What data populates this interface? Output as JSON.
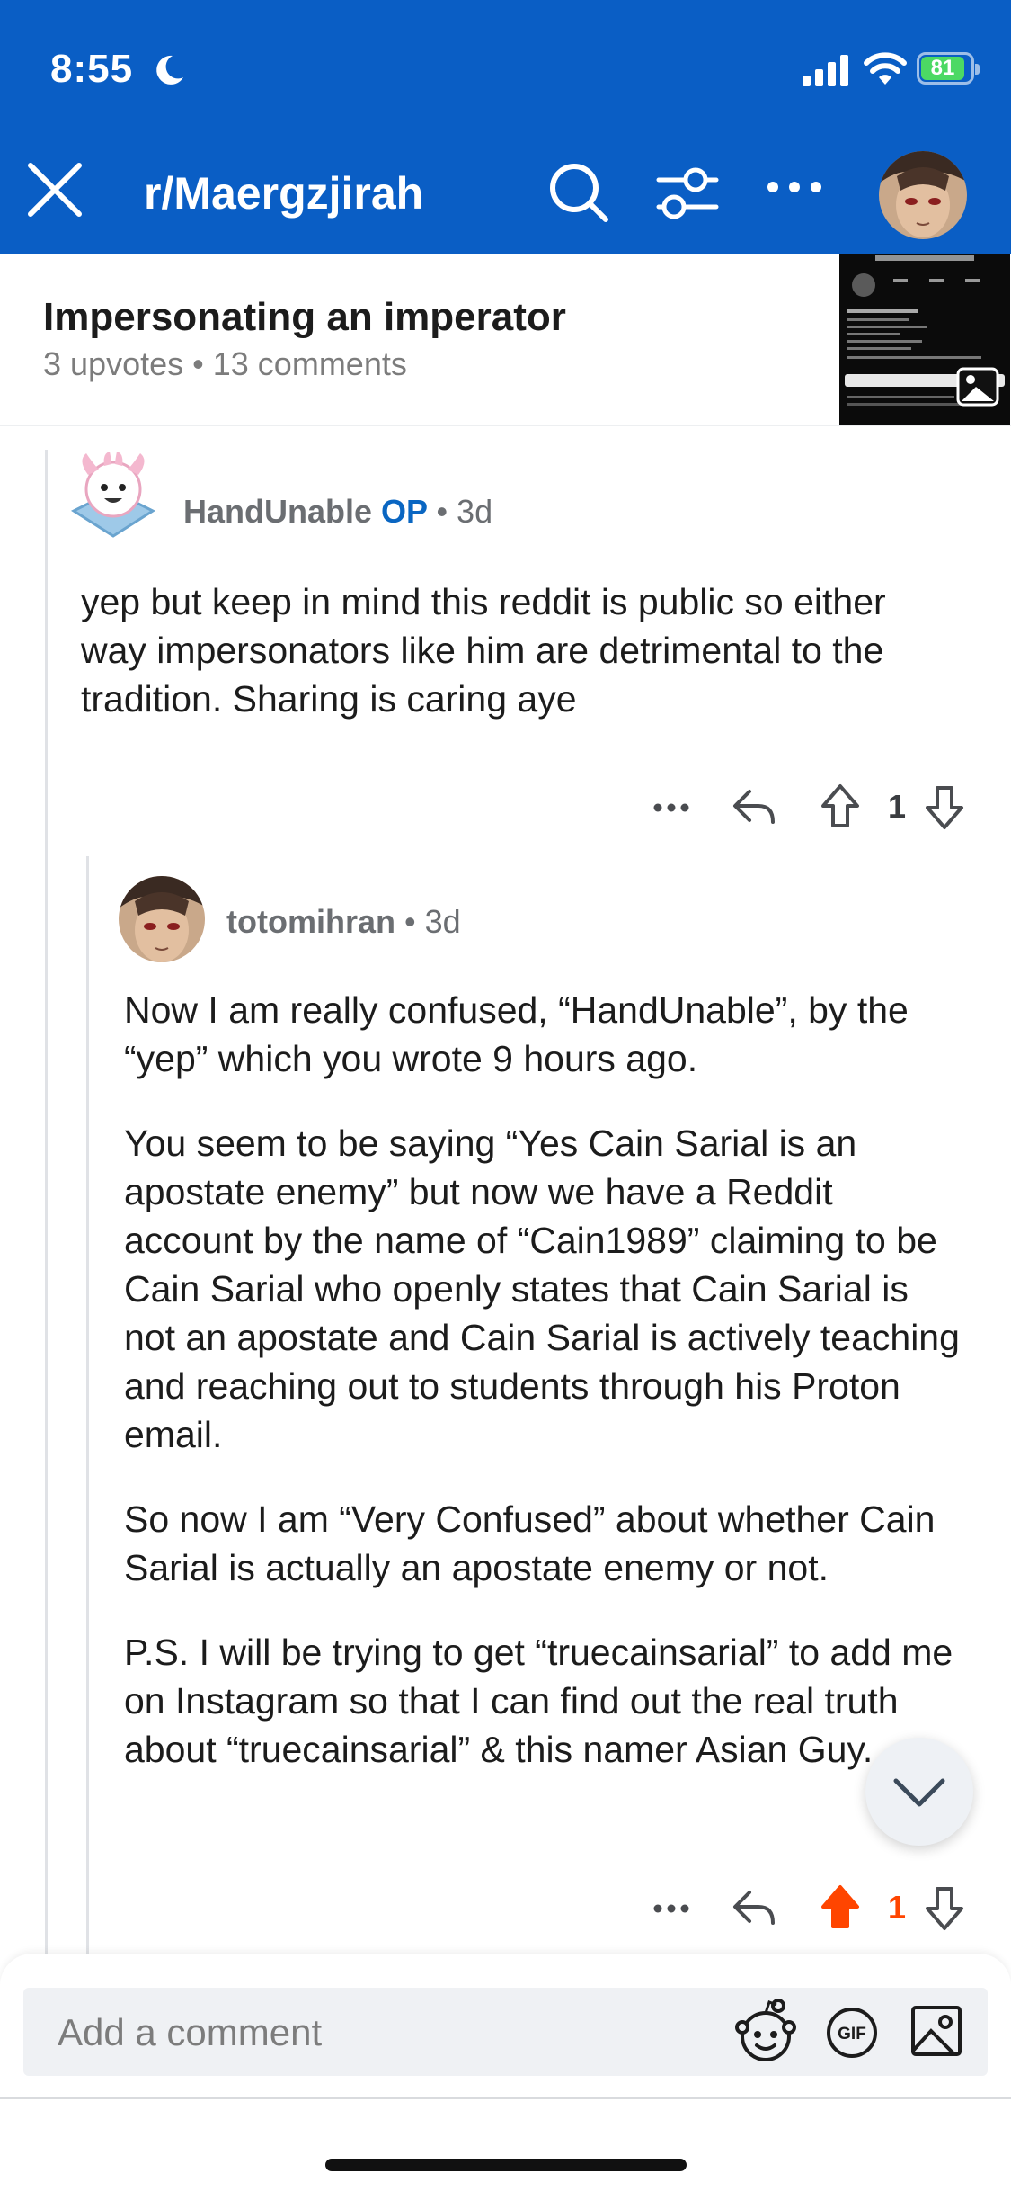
{
  "status_bar": {
    "time": "8:55",
    "battery": "81"
  },
  "header": {
    "subreddit": "r/Maergzjirah"
  },
  "post": {
    "title": "Impersonating an imperator",
    "upvotes": "3 upvotes",
    "separator": "•",
    "comments": "13 comments"
  },
  "comments": [
    {
      "username": "HandUnable",
      "op_label": "OP",
      "time": "• 3d",
      "body": [
        "yep but keep in mind this reddit is public so either way impersonators like him are detrimental to the tradition. Sharing is caring aye"
      ],
      "score": "1",
      "upvoted": false
    },
    {
      "username": "totomihran",
      "time": "• 3d",
      "body": [
        "Now I am really confused, “HandUnable”, by the “yep” which you wrote 9 hours ago.",
        "You seem to be saying “Yes Cain Sarial is an apostate enemy” but now we have a Reddit account by the name of “Cain1989” claiming to be Cain Sarial who openly states that Cain Sarial is not an apostate and Cain Sarial is actively teaching and reaching out to students through his Proton email.",
        "So now I am “Very Confused” about whether Cain Sarial is actually an apostate enemy or not.",
        "P.S. I will be trying to get “truecainsarial” to add me on Instagram so that I can find out the real truth about “truecainsarial” & this namer Asian Guy."
      ],
      "score": "1",
      "upvoted": true
    }
  ],
  "composer": {
    "placeholder": "Add a comment"
  },
  "colors": {
    "header_bg": "#0a5ec5",
    "upvote_active": "#ff4500",
    "op_blue": "#0a66c2"
  }
}
